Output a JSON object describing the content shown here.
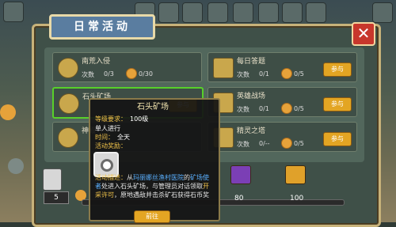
{
  "panel": {
    "title": "日常活动",
    "close_glyph": "✕"
  },
  "activities": [
    {
      "name": "南荒入侵",
      "count_label": "次数",
      "count": "0/3",
      "reward": "0/30",
      "action": "参与"
    },
    {
      "name": "每日答题",
      "count_label": "次数",
      "count": "0/1",
      "reward": "0/5",
      "action": "参与"
    },
    {
      "name": "石头矿场",
      "count_label": "次数",
      "count": "0/1",
      "reward": "0/5",
      "action": "参与"
    },
    {
      "name": "英雄战场",
      "count_label": "次数",
      "count": "0/1",
      "reward": "0/5",
      "action": "参与"
    },
    {
      "name": "神殿",
      "count_label": "次数",
      "count": "0/1",
      "reward": "0/5",
      "action": "参与"
    },
    {
      "name": "精灵之塔",
      "count_label": "次数",
      "count": "0/--",
      "reward": "0/5",
      "action": "参与"
    }
  ],
  "progress": {
    "current": "5",
    "milestones": [
      "80",
      "100"
    ]
  },
  "popup": {
    "title": "石头矿场",
    "level_req_label": "等级要求：",
    "level_req": "100级",
    "mode": "单人进行",
    "time_label": "时间：",
    "time": "全天",
    "reward_label": "活动奖励：",
    "desc_label": "活动描述：",
    "desc_a": "从",
    "desc_place1": "玛丽娜丝渔村医院",
    "desc_b": "的",
    "desc_place2": "矿场使者",
    "desc_c": "处进入石头矿场，与管理员对话领取",
    "desc_permit": "开采许可",
    "desc_d": "，原地遇敌并击杀矿石获得石币奖",
    "go_label": "前往"
  },
  "colors": {
    "accent": "#e3a523",
    "title_bg": "#5a7da0",
    "close": "#c8372c",
    "highlight": "#58d02a"
  }
}
